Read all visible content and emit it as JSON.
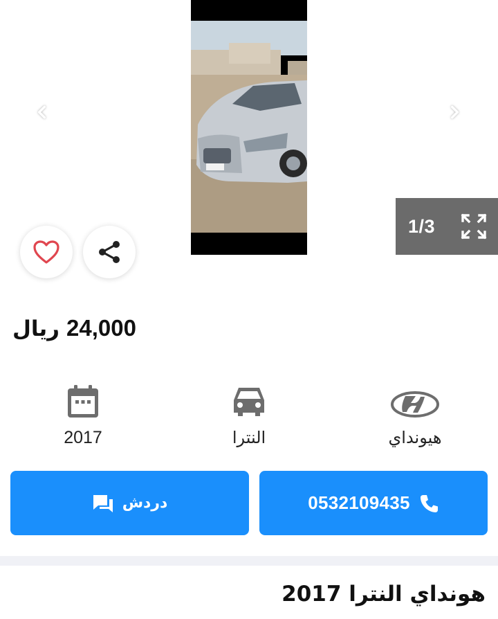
{
  "gallery": {
    "counter": "1/3",
    "prev_icon": "chevron-left-icon",
    "next_icon": "chevron-right-icon",
    "fullscreen_icon": "fullscreen-icon"
  },
  "actions": {
    "favorite_icon": "heart-icon",
    "share_icon": "share-icon"
  },
  "price": {
    "amount": "24,000",
    "currency": "ريال"
  },
  "specs": {
    "year": "2017",
    "model": "النترا",
    "make": "هيونداي"
  },
  "buttons": {
    "chat_label": "دردش",
    "phone": "0532109435"
  },
  "listing": {
    "title": "هونداي النترا 2017"
  },
  "colors": {
    "primary": "#1a8ffc",
    "heart": "#e0464f",
    "counter_bg": "#6b6b6b"
  }
}
